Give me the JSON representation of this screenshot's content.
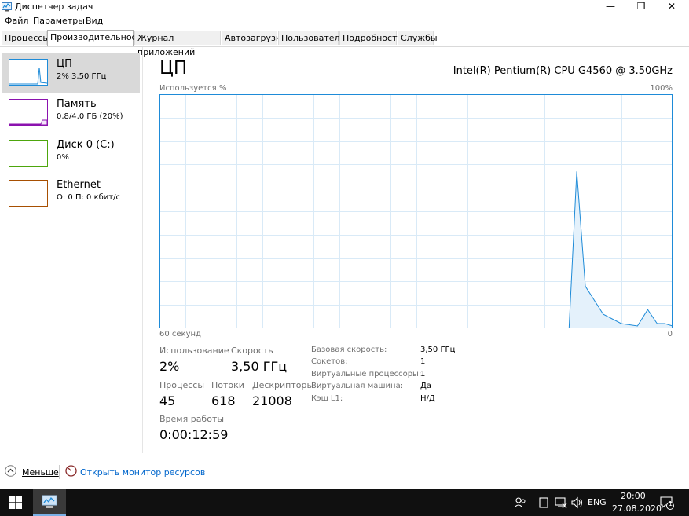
{
  "window": {
    "title": "Диспетчер задач",
    "minimize": "—",
    "maximize": "❐",
    "close": "✕"
  },
  "menu": [
    "Файл",
    "Параметры",
    "Вид"
  ],
  "tabs": [
    "Процессы",
    "Производительность",
    "Журнал приложений",
    "Автозагрузка",
    "Пользователи",
    "Подробности",
    "Службы"
  ],
  "active_tab": 1,
  "sidebar": [
    {
      "title": "ЦП",
      "sub": "2% 3,50 ГГц",
      "color": "#1e8bd8",
      "selected": true
    },
    {
      "title": "Память",
      "sub": "0,8/4,0 ГБ (20%)",
      "color": "#8b12ae",
      "selected": false
    },
    {
      "title": "Диск 0 (C:)",
      "sub": "0%",
      "color": "#4da60c",
      "selected": false
    },
    {
      "title": "Ethernet",
      "sub": "О: 0 П: 0 кбит/с",
      "color": "#a74f01",
      "selected": false
    }
  ],
  "main": {
    "title": "ЦП",
    "model": "Intel(R) Pentium(R) CPU G4560 @ 3.50GHz",
    "graph_top_left": "Используется %",
    "graph_top_right": "100%",
    "graph_bottom_left": "60 секунд",
    "graph_bottom_right": "0"
  },
  "chart_data": {
    "type": "area",
    "ylim": [
      0,
      100
    ],
    "x": [
      60,
      57.2,
      54.5,
      51.8,
      49.1,
      46.3,
      43.6,
      40.9,
      38.2,
      35.5,
      32.7,
      30.0,
      27.3,
      24.5,
      21.8,
      19.1,
      16.4,
      13.6,
      12.1,
      11.2,
      10.2,
      8.1,
      6.0,
      4.1,
      2.9,
      1.8,
      0.9,
      0
    ],
    "values": [
      0,
      0,
      0,
      0,
      0,
      0,
      0,
      0,
      0,
      0,
      0,
      0,
      0,
      0,
      0,
      0,
      0,
      0,
      0,
      67,
      18,
      6,
      2,
      1,
      8,
      2,
      2,
      1
    ],
    "color": "#1e8bd8"
  },
  "stats": {
    "usage_label": "Использование",
    "usage_value": "2%",
    "speed_label": "Скорость",
    "speed_value": "3,50 ГГц",
    "processes_label": "Процессы",
    "processes_value": "45",
    "threads_label": "Потоки",
    "threads_value": "618",
    "handles_label": "Дескрипторы",
    "handles_value": "21008",
    "uptime_label": "Время работы",
    "uptime_value": "0:00:12:59"
  },
  "details": [
    {
      "key": "Базовая скорость:",
      "value": "3,50 ГГц"
    },
    {
      "key": "Сокетов:",
      "value": "1"
    },
    {
      "key": "Виртуальные процессоры:",
      "value": "1"
    },
    {
      "key": "Виртуальная машина:",
      "value": "Да"
    },
    {
      "key": "Кэш L1:",
      "value": "Н/Д"
    }
  ],
  "footer": {
    "less": "Меньше",
    "resource_monitor": "Открыть монитор ресурсов"
  },
  "taskbar": {
    "lang": "ENG",
    "time": "20:00",
    "date": "27.08.2020",
    "notifications": "1"
  },
  "colors": {
    "accent": "#1e8bd8",
    "link": "#0066cc",
    "graph_border": "#1e8bd8",
    "grid": "#d9eaf7"
  }
}
